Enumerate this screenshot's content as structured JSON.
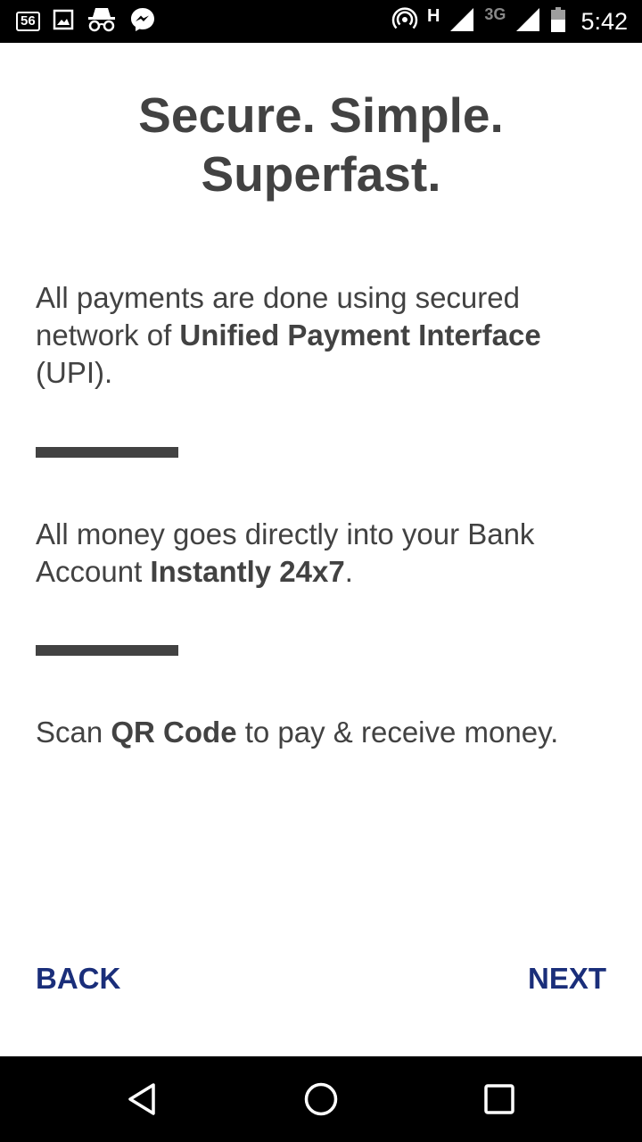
{
  "status_bar": {
    "notification_badge": "56",
    "icons": [
      "notification-count-icon",
      "image-icon",
      "incognito-icon",
      "messenger-icon",
      "hotspot-icon",
      "signal-icon",
      "battery-icon"
    ],
    "network_type_1": "H",
    "network_type_2": "3G",
    "time": "5:42"
  },
  "title": {
    "line1": "Secure. Simple.",
    "line2": "Superfast."
  },
  "features": [
    {
      "pre": "All payments are done using secured network of ",
      "bold": "Unified Payment Interface",
      "post": " (UPI)."
    },
    {
      "pre": "All money goes directly into your Bank Account ",
      "bold": "Instantly 24x7",
      "post": "."
    },
    {
      "pre": "Scan ",
      "bold": "QR Code",
      "post": " to pay & receive money."
    }
  ],
  "buttons": {
    "back": "BACK",
    "next": "NEXT"
  },
  "nav_bar": {
    "icons": [
      "back-triangle-icon",
      "home-circle-icon",
      "recents-square-icon"
    ]
  },
  "colors": {
    "text": "#424242",
    "accent": "#1a2e7a",
    "bars": "#000000"
  }
}
